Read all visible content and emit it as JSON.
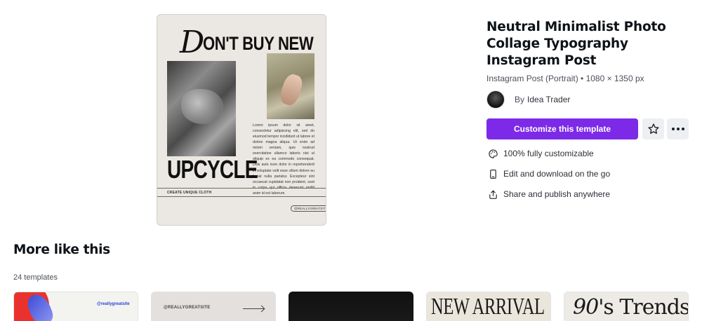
{
  "preview": {
    "headline_initial": "D",
    "headline_rest": "ON'T BUY NEW",
    "side_headline": "UPCYCLE",
    "body_text": "Lorem ipsum dolor sit amet, consectetur adipiscing elit, sed do eiusmod tempor incididunt ut labore et dolore magna aliqua. Ut enim ad minim veniam, quis nostrud exercitation ullamco laboris nisi ut aliquip ex ea commodo consequat. Duis aute irure dolor in reprehenderit in voluptate velit esse cillum dolore eu fugiat nulla pariatur. Excepteur sint occaecat cupidatat non proident, sunt in culpa qui officia deserunt mollit anim id est laborum.",
    "caption": "CREATE UNIQUE CLOTH",
    "handle": "@REALLYGREATSITE"
  },
  "template": {
    "title": "Neutral Minimalist Photo Collage Typography Instagram Post",
    "meta": "Instagram Post (Portrait) • 1080 × 1350 px",
    "by_label": "By",
    "author": "Idea Trader",
    "cta_label": "Customize this template"
  },
  "icons": {
    "star": "star-icon",
    "more": "more-dots-icon",
    "palette": "palette-icon",
    "phone": "phone-icon",
    "share": "share-icon"
  },
  "features": [
    {
      "label": "100% fully customizable",
      "icon": "palette-icon"
    },
    {
      "label": "Edit and download on the go",
      "icon": "phone-icon"
    },
    {
      "label": "Share and publish anywhere",
      "icon": "share-icon"
    }
  ],
  "more_like_this": {
    "title": "More like this",
    "count": "24 templates",
    "thumbnails": [
      {
        "text": "@reallygreatsite"
      },
      {
        "text": "@REALLYGREATSITE"
      },
      {
        "text": ""
      },
      {
        "text": "NEW ARRIVAL"
      },
      {
        "numeral": "90",
        "suffix": "'s Trends"
      }
    ]
  },
  "colors": {
    "accent": "#7d2ae8",
    "icon_button_bg": "#eeeff2",
    "text_primary": "#0e1318",
    "text_secondary": "#4a5059"
  }
}
